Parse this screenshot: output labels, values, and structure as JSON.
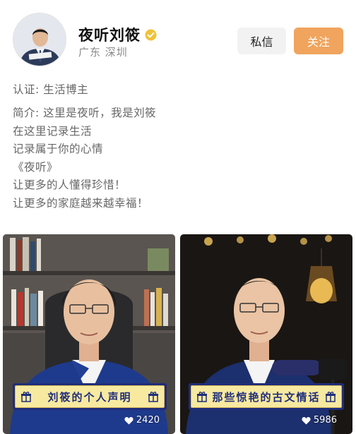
{
  "profile": {
    "name": "夜听刘筱",
    "location": "广东 深圳",
    "verified_color": "#f0c23a"
  },
  "actions": {
    "message_label": "私信",
    "follow_label": "关注",
    "follow_color": "#f0a45d"
  },
  "certification": "认证: 生活博主",
  "bio": [
    "简介: 这里是夜听，我是刘筱",
    "在这里记录生活",
    "记录属于你的心情",
    "《夜听》",
    "让更多的人懂得珍惜！",
    "让更多的家庭越来越幸福！"
  ],
  "videos": [
    {
      "title": "刘筱的个人声明",
      "likes": "2420"
    },
    {
      "title": "那些惊艳的古文情话",
      "likes": "5986"
    }
  ],
  "icons": {
    "verified": "verified-badge-icon",
    "gift": "gift-icon",
    "heart": "heart-icon"
  }
}
